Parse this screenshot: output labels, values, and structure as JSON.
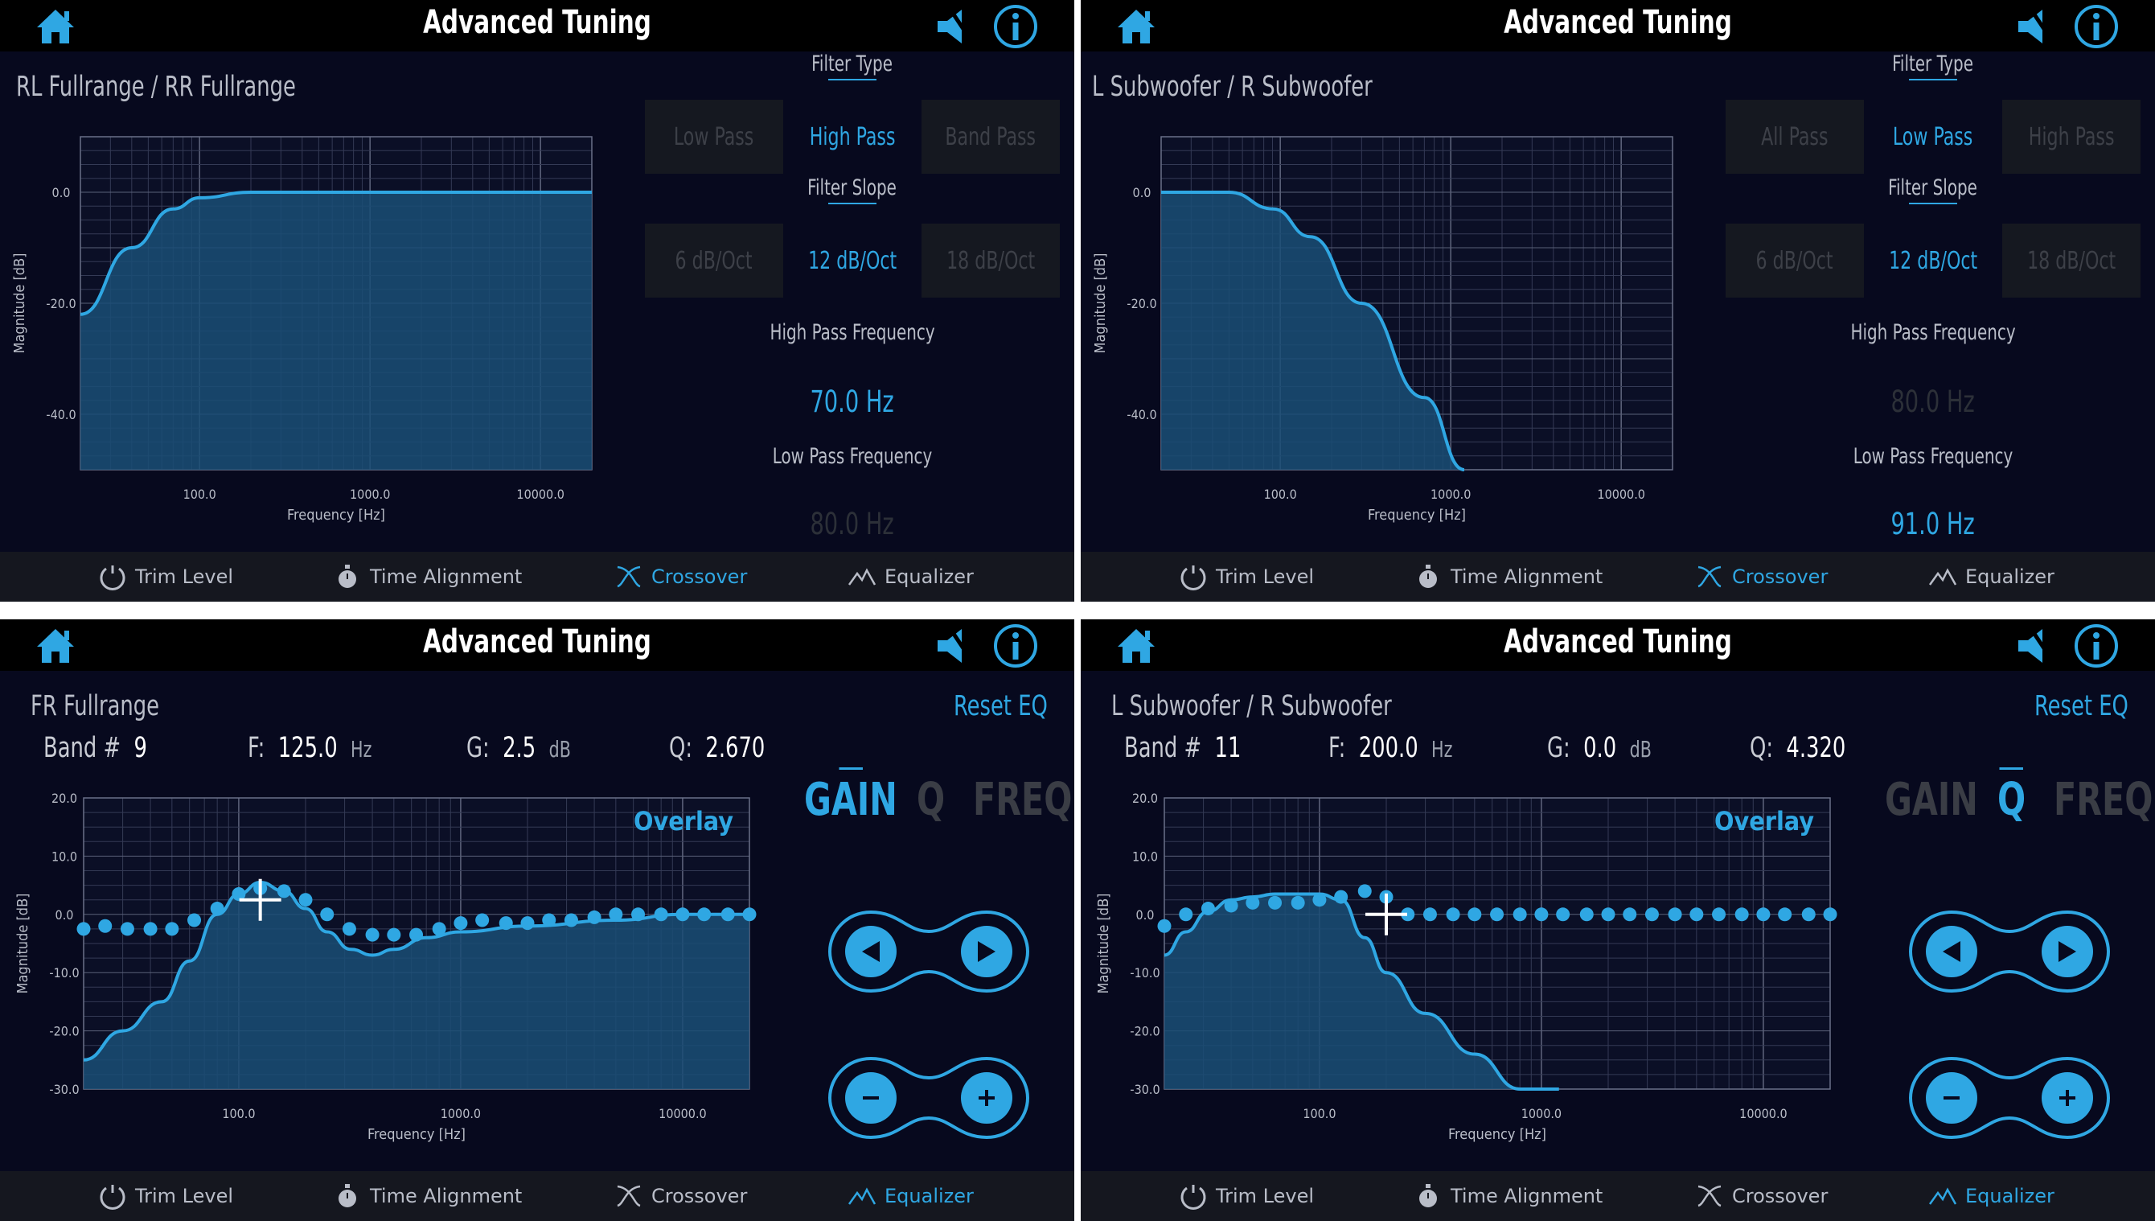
{
  "app_title": "Advanced Tuning",
  "nav": {
    "trim": "Trim Level",
    "time": "Time Alignment",
    "crossover": "Crossover",
    "equalizer": "Equalizer"
  },
  "labels": {
    "filter_type": "Filter Type",
    "filter_slope": "Filter Slope",
    "hp_freq": "High Pass Frequency",
    "lp_freq": "Low Pass Frequency",
    "band": "Band #",
    "f": "F:",
    "g": "G:",
    "q": "Q:",
    "hz": "Hz",
    "db": "dB",
    "reset": "Reset EQ",
    "overlay": "Overlay",
    "mode_gain": "GAIN",
    "mode_q": "Q",
    "mode_freq": "FREQ"
  },
  "axis": {
    "xlabel": "Frequency [Hz]",
    "ylabel": "Magnitude [dB]"
  },
  "panels": [
    {
      "channel": "RL Fullrange / RR Fullrange",
      "filter_types": [
        "Low Pass",
        "High Pass",
        "Band Pass"
      ],
      "selected_type": 1,
      "slopes": [
        "6 dB/Oct",
        "12 dB/Oct",
        "18 dB/Oct"
      ],
      "selected_slope": 1,
      "hp_value": "70.0 Hz",
      "lp_value": "80.0 Hz",
      "hp_active": true,
      "lp_active": false
    },
    {
      "channel": "L Subwoofer / R Subwoofer",
      "filter_types": [
        "All Pass",
        "Low Pass",
        "High Pass"
      ],
      "selected_type": 1,
      "slopes": [
        "6 dB/Oct",
        "12 dB/Oct",
        "18 dB/Oct"
      ],
      "selected_slope": 1,
      "hp_value": "80.0 Hz",
      "lp_value": "91.0 Hz",
      "hp_active": false,
      "lp_active": true
    },
    {
      "channel": "FR Fullrange",
      "band": "9",
      "freq": "125.0",
      "gain": "2.5",
      "q": "2.670",
      "active_mode": "gain"
    },
    {
      "channel": "L Subwoofer / R Subwoofer",
      "band": "11",
      "freq": "200.0",
      "gain": "0.0",
      "q": "4.320",
      "active_mode": "q"
    }
  ],
  "chart_data": [
    {
      "type": "area",
      "title": "",
      "xlabel": "Frequency [Hz]",
      "ylabel": "Magnitude [dB]",
      "x_scale": "log",
      "xlim": [
        20,
        20000
      ],
      "ylim": [
        -50,
        10
      ],
      "x_ticks": [
        "100.0",
        "1000.0",
        "10000.0"
      ],
      "y_ticks": [
        "0.0",
        "-20.0",
        "-40.0"
      ],
      "series": [
        {
          "filter": "high-pass",
          "cutoff_hz": 70,
          "slope_db_oct": 12,
          "x": [
            20,
            40,
            70,
            100,
            200,
            1000,
            20000
          ],
          "y": [
            -22,
            -10,
            -3,
            -1,
            0,
            0,
            0
          ]
        }
      ]
    },
    {
      "type": "area",
      "title": "",
      "xlabel": "Frequency [Hz]",
      "ylabel": "Magnitude [dB]",
      "x_scale": "log",
      "xlim": [
        20,
        20000
      ],
      "ylim": [
        -50,
        10
      ],
      "x_ticks": [
        "100.0",
        "1000.0",
        "10000.0"
      ],
      "y_ticks": [
        "0.0",
        "-20.0",
        "-40.0"
      ],
      "series": [
        {
          "filter": "low-pass",
          "cutoff_hz": 91,
          "slope_db_oct": 12,
          "x": [
            20,
            50,
            91,
            150,
            300,
            700,
            1200
          ],
          "y": [
            0,
            0,
            -3,
            -8,
            -20,
            -37,
            -50
          ]
        }
      ]
    },
    {
      "type": "line",
      "title": "",
      "xlabel": "Frequency [Hz]",
      "ylabel": "Magnitude [dB]",
      "x_scale": "log",
      "xlim": [
        20,
        20000
      ],
      "ylim": [
        -30,
        20
      ],
      "x_ticks": [
        "100.0",
        "1000.0",
        "10000.0"
      ],
      "y_ticks": [
        "20.0",
        "10.0",
        "0.0",
        "-10.0",
        "-20.0",
        "-30.0"
      ],
      "curve": {
        "x": [
          20,
          30,
          45,
          60,
          80,
          100,
          125,
          160,
          200,
          250,
          320,
          400,
          500,
          700,
          1000,
          2000,
          5000,
          10000,
          20000
        ],
        "y": [
          -25,
          -20,
          -15,
          -8,
          0,
          3.5,
          5.5,
          4,
          1,
          -3,
          -6,
          -7,
          -6,
          -4,
          -3,
          -2,
          -1,
          0,
          0
        ]
      },
      "band_points": {
        "x": [
          20,
          25,
          31.5,
          40,
          50,
          63,
          80,
          100,
          125,
          160,
          200,
          250,
          315,
          400,
          500,
          630,
          800,
          1000,
          1250,
          1600,
          2000,
          2500,
          3150,
          4000,
          5000,
          6300,
          8000,
          10000,
          12500,
          16000,
          20000
        ],
        "y": [
          -2.5,
          -2,
          -2.5,
          -2.5,
          -2.5,
          -1,
          1,
          3.5,
          4.5,
          4,
          2.5,
          0,
          -2.5,
          -3.5,
          -3.5,
          -3.5,
          -2.5,
          -1.5,
          -1,
          -1.5,
          -1.5,
          -1,
          -1,
          -0.5,
          0,
          0,
          0,
          0,
          0,
          0,
          0
        ]
      },
      "selected_point": {
        "x": 125,
        "y": 2.5
      }
    },
    {
      "type": "line",
      "title": "",
      "xlabel": "Frequency [Hz]",
      "ylabel": "Magnitude [dB]",
      "x_scale": "log",
      "xlim": [
        20,
        20000
      ],
      "ylim": [
        -30,
        20
      ],
      "x_ticks": [
        "100.0",
        "1000.0",
        "10000.0"
      ],
      "y_ticks": [
        "20.0",
        "10.0",
        "0.0",
        "-10.0",
        "-20.0",
        "-30.0"
      ],
      "curve": {
        "x": [
          20,
          25,
          31.5,
          40,
          50,
          63,
          80,
          100,
          125,
          160,
          200,
          300,
          500,
          800,
          1200
        ],
        "y": [
          -7,
          -3,
          0.5,
          2.5,
          3,
          3.5,
          3.5,
          3.5,
          2.5,
          -4,
          -10,
          -17,
          -24,
          -30,
          -30
        ]
      },
      "band_points": {
        "x": [
          20,
          25,
          31.5,
          40,
          50,
          63,
          80,
          100,
          125,
          160,
          200,
          250,
          315,
          400,
          500,
          630,
          800,
          1000,
          1250,
          1600,
          2000,
          2500,
          3150,
          4000,
          5000,
          6300,
          8000,
          10000,
          12500,
          16000,
          20000
        ],
        "y": [
          -2,
          0,
          1,
          1.5,
          2,
          2,
          2,
          2.5,
          3,
          4,
          3,
          0,
          0,
          0,
          0,
          0,
          0,
          0,
          0,
          0,
          0,
          0,
          0,
          0,
          0,
          0,
          0,
          0,
          0,
          0,
          0
        ]
      },
      "selected_point": {
        "x": 200,
        "y": 0
      }
    }
  ],
  "colors": {
    "accent": "#2fa7e3",
    "background": "#07091e",
    "bar": "#000000",
    "fill": "#1a4e76"
  }
}
